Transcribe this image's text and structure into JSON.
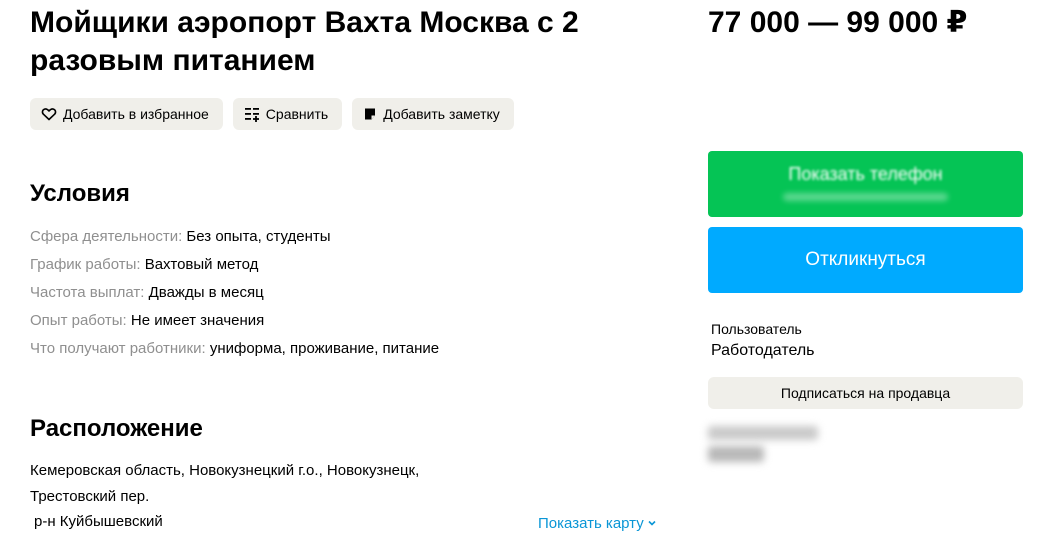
{
  "listing": {
    "title": "Мойщики аэропорт Вахта Москва с 2 разовым питанием",
    "price": "77 000 — 99 000 ₽"
  },
  "actions": {
    "favorite": "Добавить в избранное",
    "compare": "Сравнить",
    "note": "Добавить заметку"
  },
  "conditions": {
    "heading": "Условия",
    "items": [
      {
        "key": "Сфера деятельности:",
        "value": "Без опыта, студенты"
      },
      {
        "key": "График работы:",
        "value": "Вахтовый метод"
      },
      {
        "key": "Частота выплат:",
        "value": "Дважды в месяц"
      },
      {
        "key": "Опыт работы:",
        "value": "Не имеет значения"
      },
      {
        "key": "Что получают работники:",
        "value": "униформа, проживание, питание"
      }
    ]
  },
  "location": {
    "heading": "Расположение",
    "address": "Кемеровская область, Новокузнецкий г.о., Новокузнецк, Трестовский пер.",
    "district": "р-н Куйбышевский",
    "map_link": "Показать карту"
  },
  "sidebar": {
    "show_phone": "Показать телефон",
    "reply": "Откликнуться",
    "seller_type": "Пользователь",
    "seller_name": "Работодатель",
    "subscribe": "Подписаться на продавца"
  },
  "colors": {
    "phone_button": "#05c455",
    "reply_button": "#00aaff",
    "link": "#0a96d6",
    "chip_bg": "#f0efea"
  }
}
